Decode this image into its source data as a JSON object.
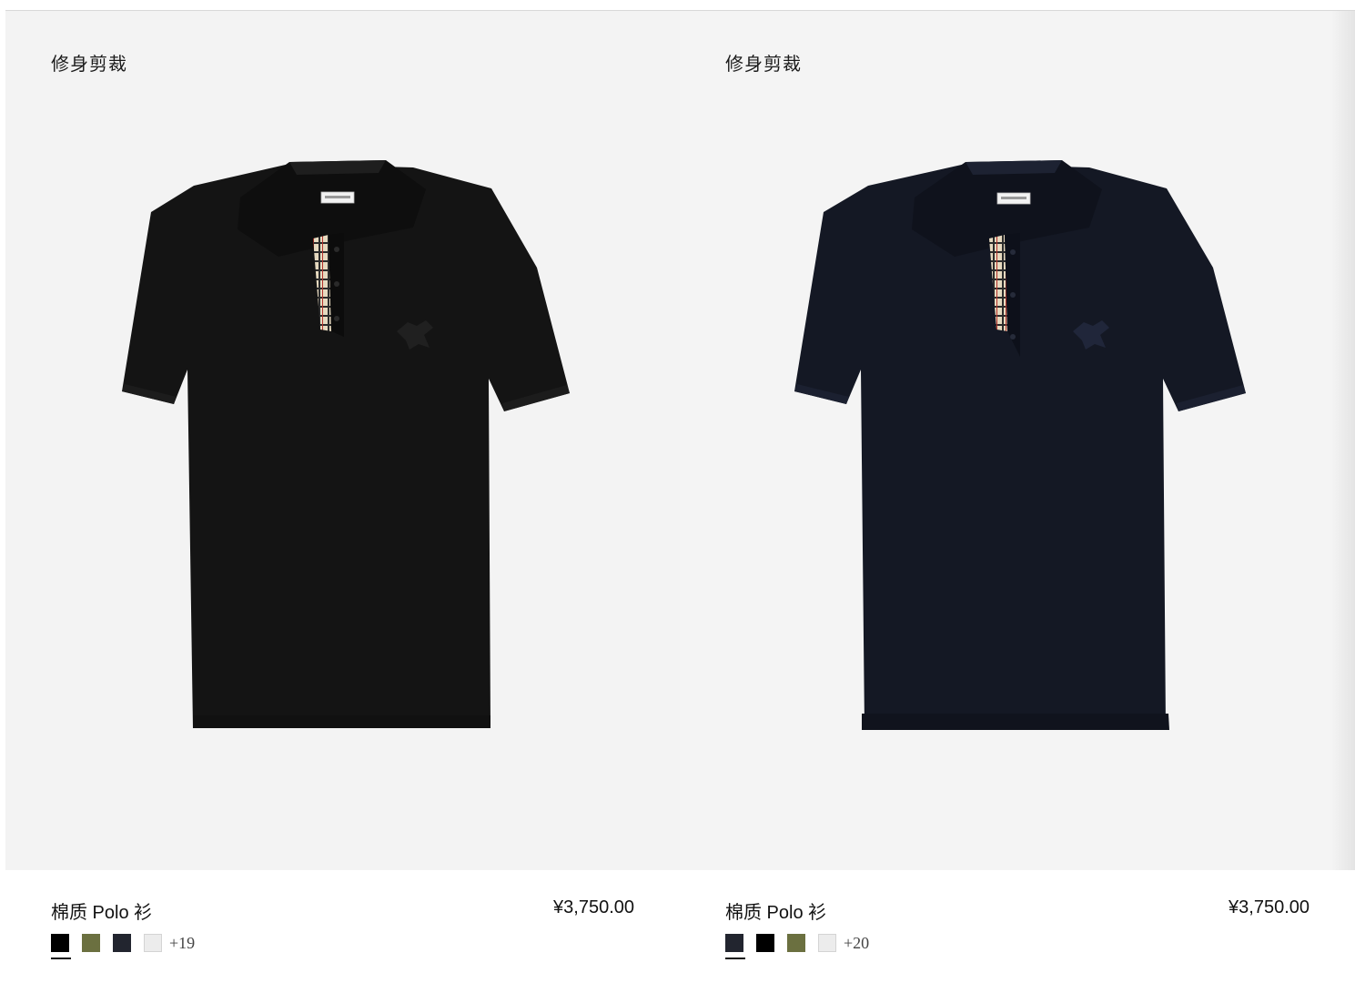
{
  "products": [
    {
      "fit_tag": "修身剪裁",
      "name": "棉质 Polo 衫",
      "price": "¥3,750.00",
      "garment_color": "#141414",
      "swatches": [
        {
          "color": "#000000",
          "selected": true
        },
        {
          "color": "#6b7040",
          "selected": false
        },
        {
          "color": "#22252f",
          "selected": false
        },
        {
          "color": "#ececec",
          "selected": false
        }
      ],
      "more_colors": "+19"
    },
    {
      "fit_tag": "修身剪裁",
      "name": "棉质 Polo 衫",
      "price": "¥3,750.00",
      "garment_color": "#141824",
      "swatches": [
        {
          "color": "#22252f",
          "selected": true
        },
        {
          "color": "#000000",
          "selected": false
        },
        {
          "color": "#6b7040",
          "selected": false
        },
        {
          "color": "#ececec",
          "selected": false
        }
      ],
      "more_colors": "+20"
    }
  ],
  "colors": {
    "image_background": "#f4f4f4",
    "text": "#111111",
    "check_pattern": [
      "#e6d9bf",
      "#2b2b2b",
      "#b3322b"
    ]
  }
}
